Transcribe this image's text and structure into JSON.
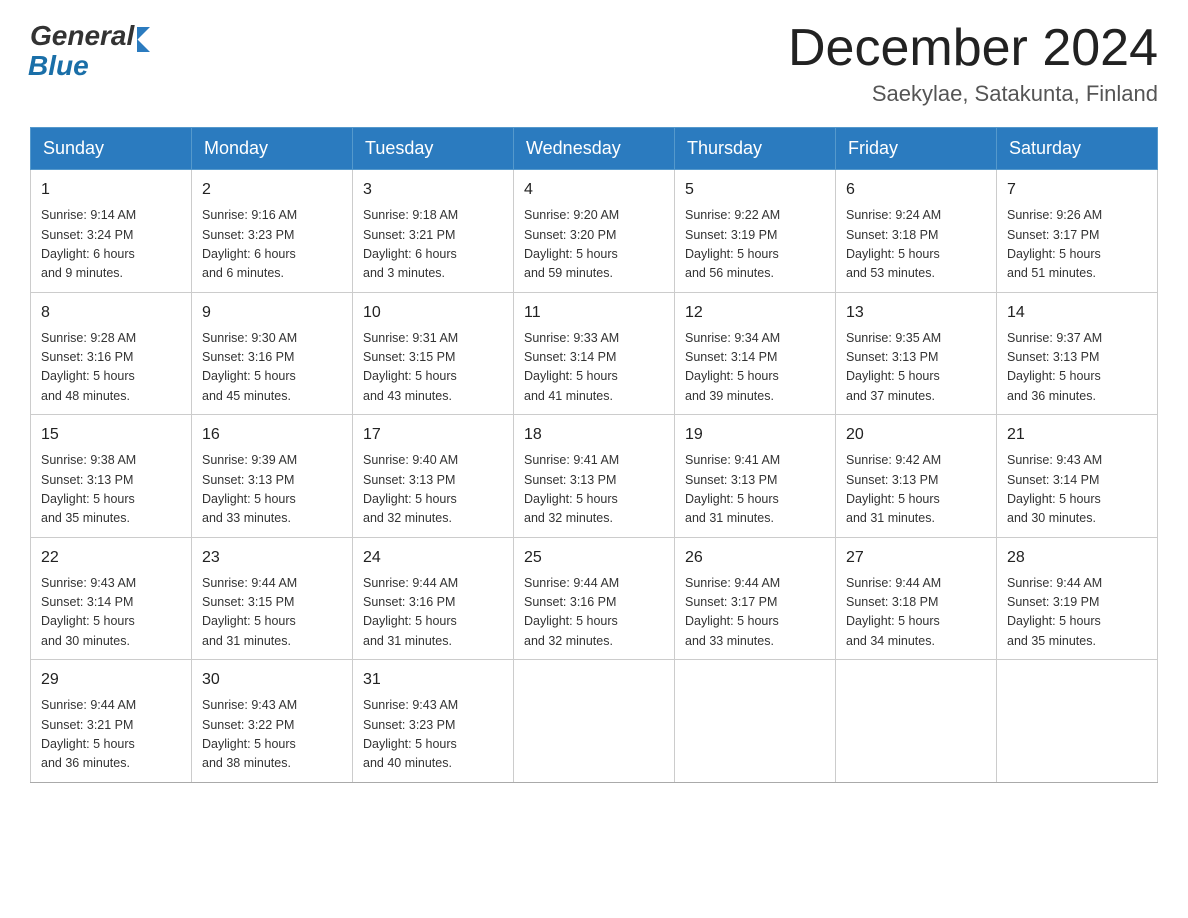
{
  "logo": {
    "general": "General",
    "blue": "Blue"
  },
  "title": "December 2024",
  "subtitle": "Saekylae, Satakunta, Finland",
  "days_of_week": [
    "Sunday",
    "Monday",
    "Tuesday",
    "Wednesday",
    "Thursday",
    "Friday",
    "Saturday"
  ],
  "weeks": [
    [
      {
        "day": "1",
        "info": "Sunrise: 9:14 AM\nSunset: 3:24 PM\nDaylight: 6 hours\nand 9 minutes."
      },
      {
        "day": "2",
        "info": "Sunrise: 9:16 AM\nSunset: 3:23 PM\nDaylight: 6 hours\nand 6 minutes."
      },
      {
        "day": "3",
        "info": "Sunrise: 9:18 AM\nSunset: 3:21 PM\nDaylight: 6 hours\nand 3 minutes."
      },
      {
        "day": "4",
        "info": "Sunrise: 9:20 AM\nSunset: 3:20 PM\nDaylight: 5 hours\nand 59 minutes."
      },
      {
        "day": "5",
        "info": "Sunrise: 9:22 AM\nSunset: 3:19 PM\nDaylight: 5 hours\nand 56 minutes."
      },
      {
        "day": "6",
        "info": "Sunrise: 9:24 AM\nSunset: 3:18 PM\nDaylight: 5 hours\nand 53 minutes."
      },
      {
        "day": "7",
        "info": "Sunrise: 9:26 AM\nSunset: 3:17 PM\nDaylight: 5 hours\nand 51 minutes."
      }
    ],
    [
      {
        "day": "8",
        "info": "Sunrise: 9:28 AM\nSunset: 3:16 PM\nDaylight: 5 hours\nand 48 minutes."
      },
      {
        "day": "9",
        "info": "Sunrise: 9:30 AM\nSunset: 3:16 PM\nDaylight: 5 hours\nand 45 minutes."
      },
      {
        "day": "10",
        "info": "Sunrise: 9:31 AM\nSunset: 3:15 PM\nDaylight: 5 hours\nand 43 minutes."
      },
      {
        "day": "11",
        "info": "Sunrise: 9:33 AM\nSunset: 3:14 PM\nDaylight: 5 hours\nand 41 minutes."
      },
      {
        "day": "12",
        "info": "Sunrise: 9:34 AM\nSunset: 3:14 PM\nDaylight: 5 hours\nand 39 minutes."
      },
      {
        "day": "13",
        "info": "Sunrise: 9:35 AM\nSunset: 3:13 PM\nDaylight: 5 hours\nand 37 minutes."
      },
      {
        "day": "14",
        "info": "Sunrise: 9:37 AM\nSunset: 3:13 PM\nDaylight: 5 hours\nand 36 minutes."
      }
    ],
    [
      {
        "day": "15",
        "info": "Sunrise: 9:38 AM\nSunset: 3:13 PM\nDaylight: 5 hours\nand 35 minutes."
      },
      {
        "day": "16",
        "info": "Sunrise: 9:39 AM\nSunset: 3:13 PM\nDaylight: 5 hours\nand 33 minutes."
      },
      {
        "day": "17",
        "info": "Sunrise: 9:40 AM\nSunset: 3:13 PM\nDaylight: 5 hours\nand 32 minutes."
      },
      {
        "day": "18",
        "info": "Sunrise: 9:41 AM\nSunset: 3:13 PM\nDaylight: 5 hours\nand 32 minutes."
      },
      {
        "day": "19",
        "info": "Sunrise: 9:41 AM\nSunset: 3:13 PM\nDaylight: 5 hours\nand 31 minutes."
      },
      {
        "day": "20",
        "info": "Sunrise: 9:42 AM\nSunset: 3:13 PM\nDaylight: 5 hours\nand 31 minutes."
      },
      {
        "day": "21",
        "info": "Sunrise: 9:43 AM\nSunset: 3:14 PM\nDaylight: 5 hours\nand 30 minutes."
      }
    ],
    [
      {
        "day": "22",
        "info": "Sunrise: 9:43 AM\nSunset: 3:14 PM\nDaylight: 5 hours\nand 30 minutes."
      },
      {
        "day": "23",
        "info": "Sunrise: 9:44 AM\nSunset: 3:15 PM\nDaylight: 5 hours\nand 31 minutes."
      },
      {
        "day": "24",
        "info": "Sunrise: 9:44 AM\nSunset: 3:16 PM\nDaylight: 5 hours\nand 31 minutes."
      },
      {
        "day": "25",
        "info": "Sunrise: 9:44 AM\nSunset: 3:16 PM\nDaylight: 5 hours\nand 32 minutes."
      },
      {
        "day": "26",
        "info": "Sunrise: 9:44 AM\nSunset: 3:17 PM\nDaylight: 5 hours\nand 33 minutes."
      },
      {
        "day": "27",
        "info": "Sunrise: 9:44 AM\nSunset: 3:18 PM\nDaylight: 5 hours\nand 34 minutes."
      },
      {
        "day": "28",
        "info": "Sunrise: 9:44 AM\nSunset: 3:19 PM\nDaylight: 5 hours\nand 35 minutes."
      }
    ],
    [
      {
        "day": "29",
        "info": "Sunrise: 9:44 AM\nSunset: 3:21 PM\nDaylight: 5 hours\nand 36 minutes."
      },
      {
        "day": "30",
        "info": "Sunrise: 9:43 AM\nSunset: 3:22 PM\nDaylight: 5 hours\nand 38 minutes."
      },
      {
        "day": "31",
        "info": "Sunrise: 9:43 AM\nSunset: 3:23 PM\nDaylight: 5 hours\nand 40 minutes."
      },
      null,
      null,
      null,
      null
    ]
  ]
}
